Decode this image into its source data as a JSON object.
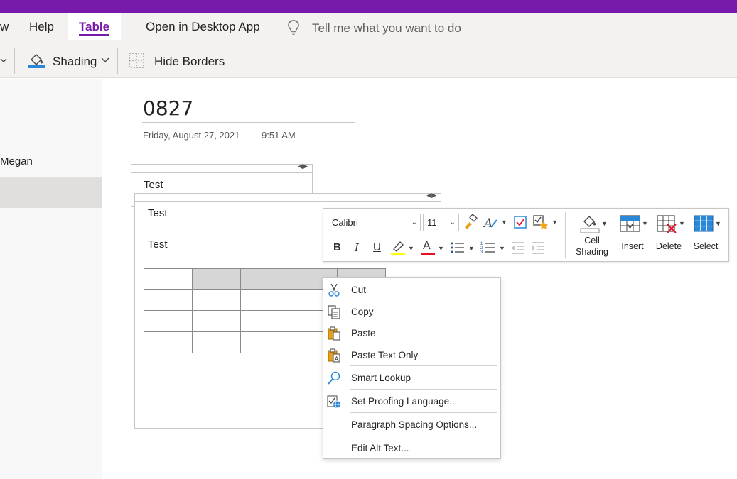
{
  "ribbon": {
    "tabs": [
      {
        "label": "w"
      },
      {
        "label": "Help"
      },
      {
        "label": "Table"
      },
      {
        "label": "Open in Desktop App"
      }
    ],
    "tell_me_placeholder": "Tell me what you want to do",
    "commands": {
      "shading_label": "Shading",
      "hide_borders_label": "Hide Borders"
    },
    "accent_color": "#7719aa"
  },
  "nav": {
    "items": [
      {
        "label": "Megan"
      }
    ]
  },
  "page": {
    "title": "0827",
    "date": "Friday, August 27, 2021",
    "time": "9:51 AM",
    "container1_text": "Test",
    "container2_line1": "Test",
    "container2_line2": "Test",
    "table": {
      "rows": 4,
      "cols": 5,
      "shaded_cells": [
        [
          0,
          1
        ],
        [
          0,
          2
        ],
        [
          0,
          3
        ],
        [
          0,
          4
        ]
      ]
    }
  },
  "mini_toolbar": {
    "font_name": "Calibri",
    "font_size": "11",
    "bold": "B",
    "italic": "I",
    "underline": "U",
    "font_color_glyph": "A",
    "cell_shading_label_1": "Cell",
    "cell_shading_label_2": "Shading",
    "insert_label": "Insert",
    "delete_label": "Delete",
    "select_label": "Select",
    "highlight_color": "#ffff00",
    "font_color": "#e81123"
  },
  "context_menu": {
    "items": [
      {
        "label": "Cut",
        "icon": "scissors-icon"
      },
      {
        "label": "Copy",
        "icon": "copy-icon"
      },
      {
        "label": "Paste",
        "icon": "paste-icon"
      },
      {
        "label": "Paste Text Only",
        "icon": "paste-text-icon"
      },
      {
        "label": "Smart Lookup",
        "icon": "smart-lookup-icon"
      },
      {
        "label": "Set Proofing Language...",
        "icon": "proofing-language-icon"
      },
      {
        "label": "Paragraph Spacing Options...",
        "icon": ""
      },
      {
        "label": "Edit Alt Text...",
        "icon": ""
      }
    ]
  }
}
